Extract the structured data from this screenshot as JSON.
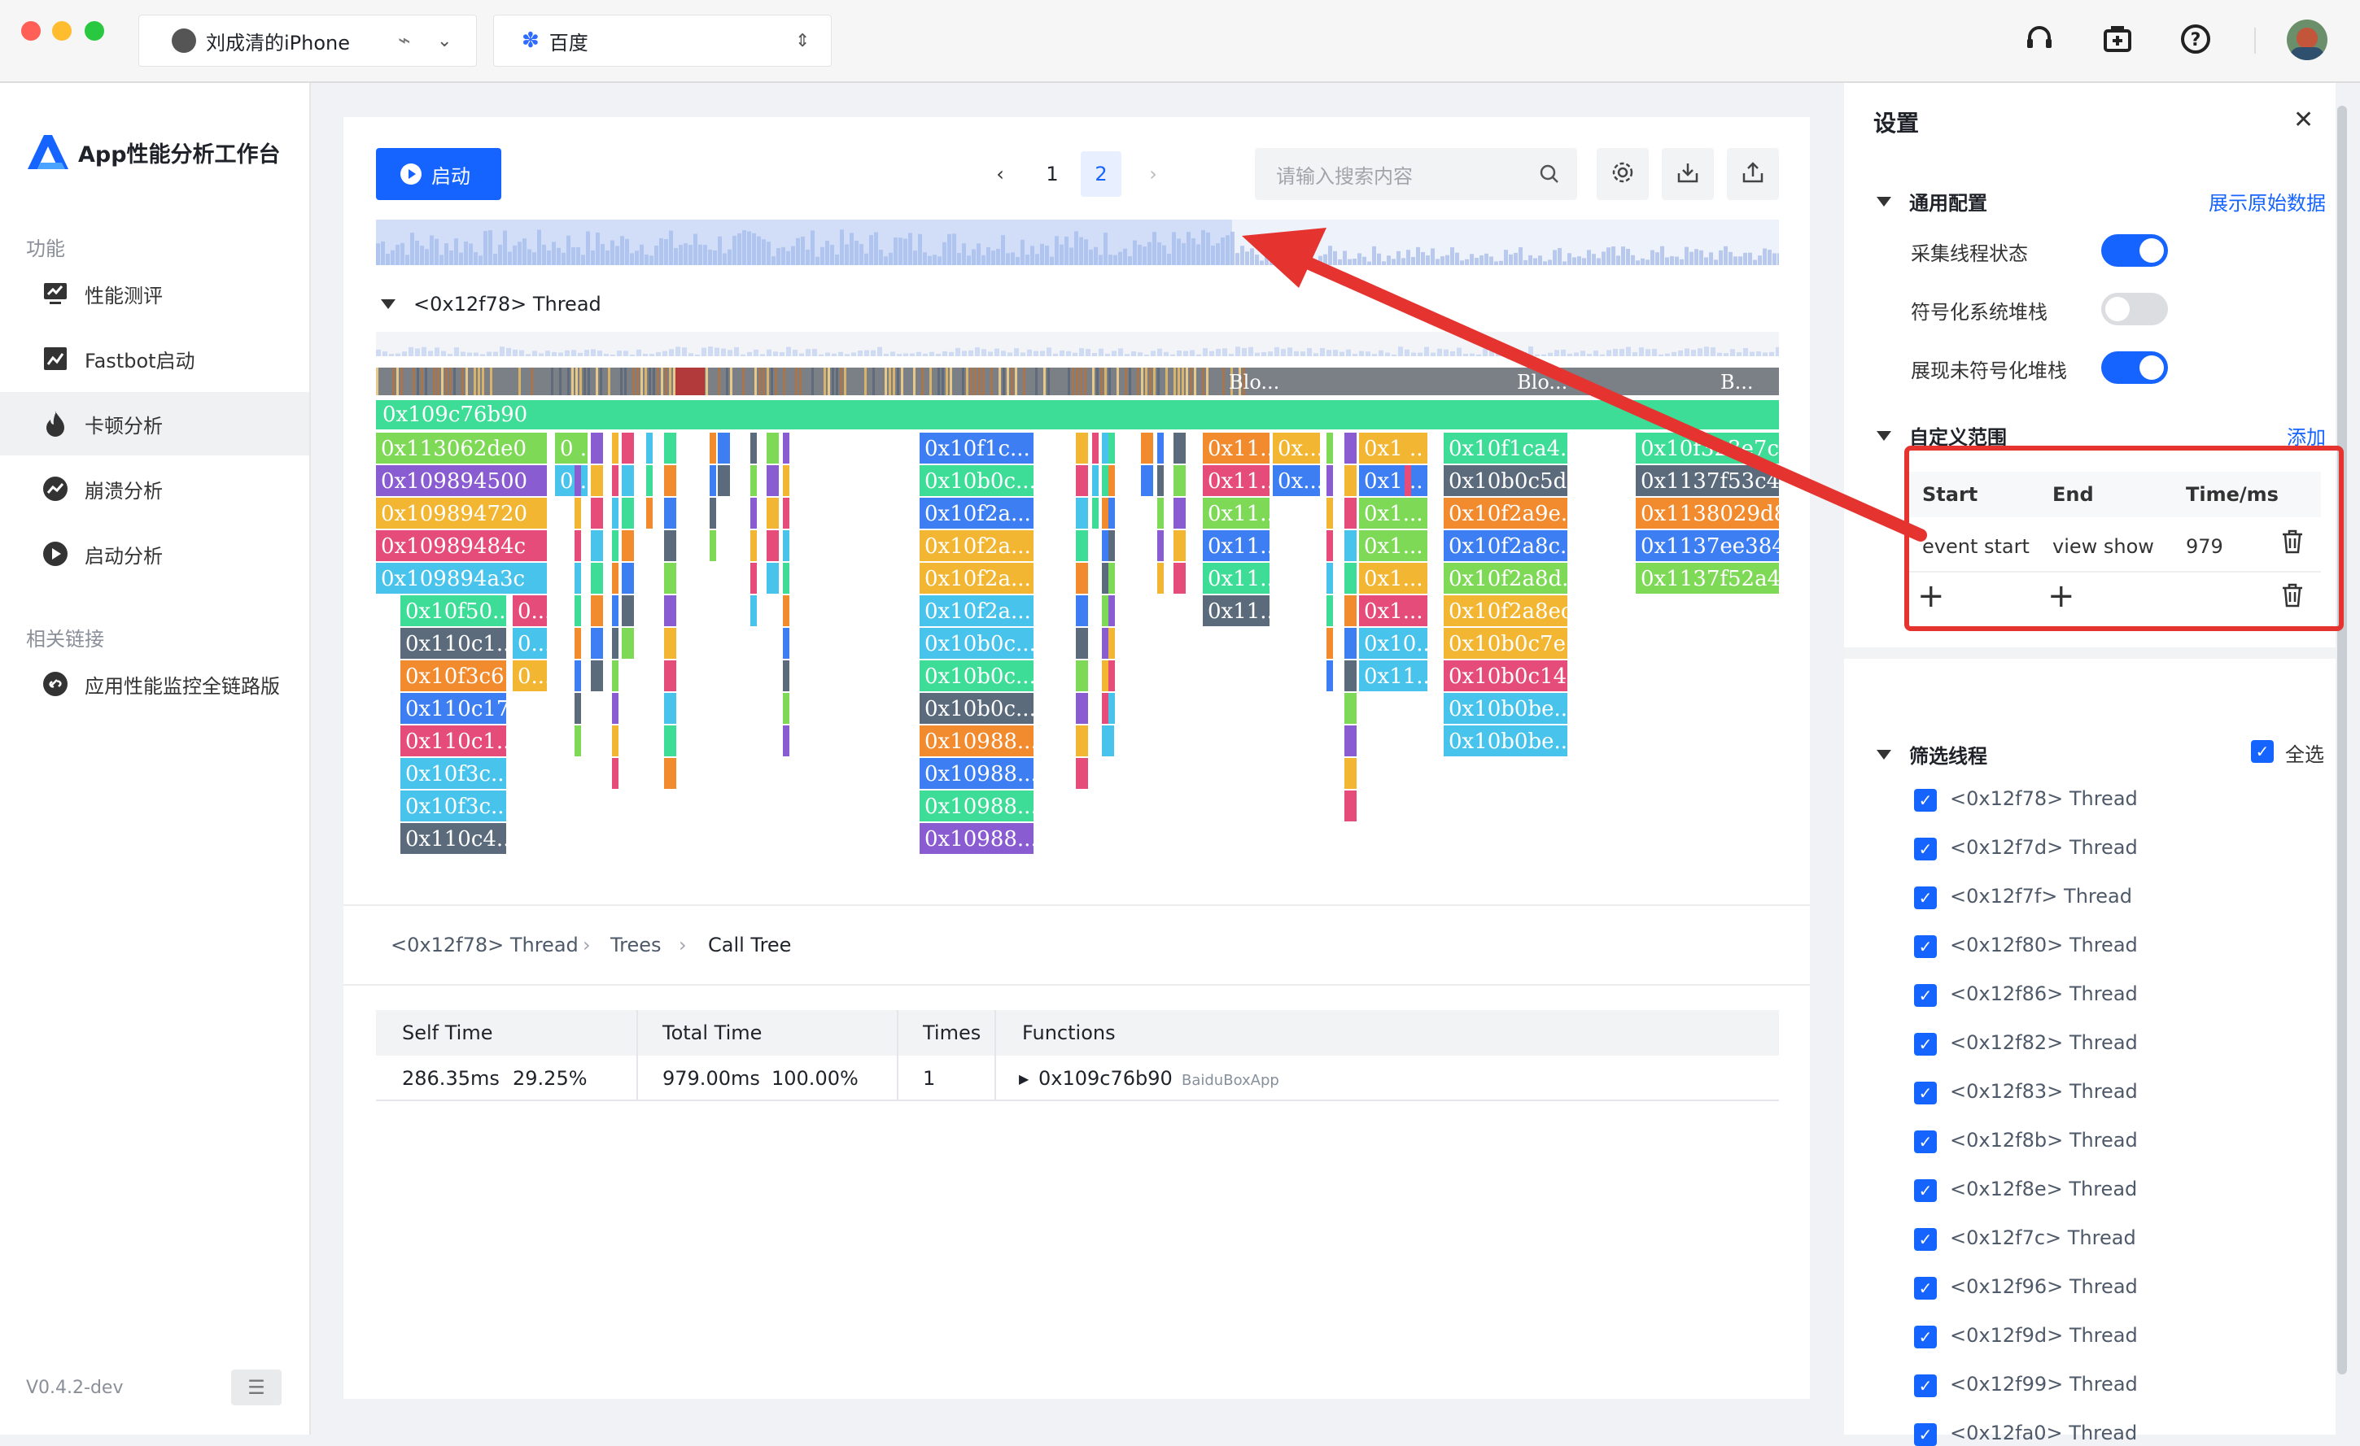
{
  "titlebar": {
    "device_name": "刘成清的iPhone",
    "app_name": "百度"
  },
  "sidebar": {
    "brand": "App性能分析工作台",
    "section_function": "功能",
    "items": [
      {
        "label": "性能测评",
        "icon": "monitor-icon"
      },
      {
        "label": "Fastbot启动",
        "icon": "chart-icon"
      },
      {
        "label": "卡顿分析",
        "icon": "fire-icon"
      },
      {
        "label": "崩溃分析",
        "icon": "trend-icon"
      },
      {
        "label": "启动分析",
        "icon": "play-icon"
      }
    ],
    "section_links": "相关链接",
    "link": "应用性能监控全链路版",
    "version": "V0.4.2-dev"
  },
  "toolbar": {
    "start_label": "启动",
    "pages": [
      "1",
      "2"
    ],
    "current_page": "2",
    "search_placeholder": "请输入搜索内容"
  },
  "thread_title": "<0x12f78> Thread",
  "flame": {
    "root": "0x109c76b90",
    "bar_labels": [
      "Blo...",
      "Blo...",
      "B..."
    ],
    "col1": [
      "0x113062de0",
      "0x109894500",
      "0x109894720",
      "0x10989484c",
      "0x109894a3c"
    ],
    "col1_sub": [
      "0x10f50...",
      "0x110c1...",
      "0x10f3c6...",
      "0x110c17...",
      "0x110c1...",
      "0x10f3c...",
      "0x10f3c...",
      "0x110c4..."
    ],
    "col1_extra": [
      "0...",
      "0...",
      "0..."
    ],
    "col1b": [
      "0...",
      "0..."
    ],
    "col2": [
      "0x10f1c...",
      "0x10b0c...",
      "0x10f2a...",
      "0x10f2a...",
      "0x10f2a...",
      "0x10f2a...",
      "0x10b0c...",
      "0x10b0c...",
      "0x10b0c...",
      "0x10988...",
      "0x10988...",
      "0x10988...",
      "0x10988..."
    ],
    "col3a": [
      "0x11...",
      "0x11...",
      "0x11...",
      "0x11...",
      "0x11...",
      "0x11..."
    ],
    "col3b": [
      "0x...",
      "0x..."
    ],
    "col4": [
      "0x1...",
      "0x1...",
      "0x1...",
      "0x1...",
      "0x1...",
      "0x1...",
      "0x10...",
      "0x11..."
    ],
    "col5": [
      "0x10f1ca4...",
      "0x10b0c5d...",
      "0x10f2a9e...",
      "0x10f2a8c...",
      "0x10f2a8d...",
      "0x10f2a8ec4",
      "0x10b0c7e...",
      "0x10b0c14...",
      "0x10b0be...",
      "0x10b0be..."
    ],
    "col6": [
      "0x10f323e7c",
      "0x1137f53c4",
      "0x1138029d8",
      "0x1137ee384",
      "0x1137f52a4"
    ]
  },
  "breadcrumb": [
    "<0x12f78> Thread",
    "Trees",
    "Call Tree"
  ],
  "table": {
    "headers": [
      "Self Time",
      "Total Time",
      "Times",
      "Functions"
    ],
    "row": {
      "self_time": "286.35ms",
      "self_pct": "29.25%",
      "total_time": "979.00ms",
      "total_pct": "100.00%",
      "times": "1",
      "function": "0x109c76b90",
      "module": "BaiduBoxApp"
    }
  },
  "settings": {
    "title": "设置",
    "general": "通用配置",
    "show_raw": "展示原始数据",
    "options": [
      {
        "label": "采集线程状态",
        "on": true
      },
      {
        "label": "符号化系统堆栈",
        "on": false
      },
      {
        "label": "展现未符号化堆栈",
        "on": true
      }
    ],
    "custom_range": "自定义范围",
    "add": "添加",
    "range_headers": [
      "Start",
      "End",
      "Time/ms"
    ],
    "range_row": {
      "start": "event start",
      "end": "view show",
      "time": "979"
    },
    "filter_threads": "筛选线程",
    "select_all": "全选",
    "threads": [
      "<0x12f78> Thread",
      "<0x12f7d> Thread",
      "<0x12f7f> Thread",
      "<0x12f80> Thread",
      "<0x12f86> Thread",
      "<0x12f82> Thread",
      "<0x12f83> Thread",
      "<0x12f8b> Thread",
      "<0x12f8e> Thread",
      "<0x12f7c> Thread",
      "<0x12f96> Thread",
      "<0x12f9d> Thread",
      "<0x12f99> Thread",
      "<0x12fa0> Thread"
    ]
  },
  "colors": {
    "accent": "#1664ff",
    "annotation": "#e5342f",
    "flame_root": "#3ddc97"
  }
}
